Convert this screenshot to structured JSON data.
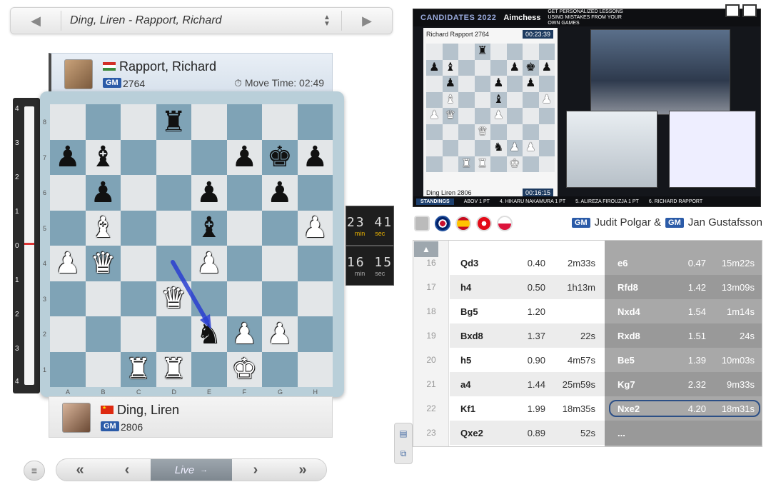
{
  "game_selector": {
    "title": "Ding, Liren - Rapport, Richard"
  },
  "top_player": {
    "name": "Rapport, Richard",
    "title": "GM",
    "rating": "2764",
    "move_time": "Move Time: 02:49"
  },
  "bottom_player": {
    "name": "Ding, Liren",
    "title": "GM",
    "rating": "2806"
  },
  "eval_bar": {
    "labels_top": [
      "4",
      "3",
      "2",
      "1",
      "0"
    ],
    "labels_bottom": [
      "1",
      "2",
      "3",
      "4"
    ],
    "evaluation": 0.0
  },
  "board": {
    "files": [
      "A",
      "B",
      "C",
      "D",
      "E",
      "F",
      "G",
      "H"
    ],
    "ranks": [
      "8",
      "7",
      "6",
      "5",
      "4",
      "3",
      "2",
      "1"
    ],
    "position": [
      [
        "",
        "",
        "",
        "r",
        "",
        "",
        "",
        ""
      ],
      [
        "p",
        "b",
        "",
        "",
        "",
        "p",
        "k",
        "p"
      ],
      [
        "",
        "p",
        "",
        "",
        "p",
        "",
        "p",
        ""
      ],
      [
        "",
        "B",
        "",
        "",
        "b",
        "",
        "",
        "P"
      ],
      [
        "P",
        "Q",
        "",
        "",
        "P",
        "",
        "",
        ""
      ],
      [
        "",
        "",
        "",
        "Q",
        "",
        "",
        "",
        ""
      ],
      [
        "",
        "",
        "",
        "",
        "n",
        "P",
        "P",
        ""
      ],
      [
        "",
        "",
        "R",
        "R",
        "",
        "K",
        "",
        ""
      ]
    ],
    "last_move_arrow": {
      "from": "d4",
      "to": "e2"
    }
  },
  "clocks": {
    "top": {
      "value": "23 41",
      "min_label": "min",
      "sec_label": "sec"
    },
    "bottom": {
      "value": "16 15",
      "min_label": "min",
      "sec_label": "sec"
    }
  },
  "nav": {
    "first": "«",
    "prev": "‹",
    "live": "Live",
    "next": "›",
    "last": "»",
    "menu": "≡"
  },
  "video": {
    "event": "CANDIDATES",
    "year": "2022",
    "sponsor": "Aimchess",
    "promo": "GET PERSONALIZED LESSONS USING MISTAKES FROM YOUR OWN GAMES",
    "board_top_player": "Richard Rapport 2764",
    "board_top_clock": "00:23:39",
    "board_bottom_player": "Ding Liren 2806",
    "board_bottom_clock": "00:16:15",
    "ticker": [
      "STANDINGS",
      "ABOV  1 PT",
      "4. HIKARU NAKAMURA  1 PT",
      "5. ALIREZA FIROUZJA  1 PT",
      "6. RICHARD RAPPORT"
    ]
  },
  "commentary": {
    "commentator_1_title": "GM",
    "commentator_1": "Judit Polgar &",
    "commentator_2_title": "GM",
    "commentator_2": "Jan Gustafsson",
    "language_flags": [
      "uk",
      "es",
      "tr",
      "pl"
    ]
  },
  "moves": [
    {
      "num": "16",
      "w": "Qd3",
      "weval": "0.40",
      "wtime": "2m33s",
      "b": "e6",
      "beval": "0.47",
      "btime": "15m22s"
    },
    {
      "num": "17",
      "w": "h4",
      "weval": "0.50",
      "wtime": "1h13m",
      "b": "Rfd8",
      "beval": "1.42",
      "btime": "13m09s"
    },
    {
      "num": "18",
      "w": "Bg5",
      "weval": "1.20",
      "wtime": "",
      "b": "Nxd4",
      "beval": "1.54",
      "btime": "1m14s"
    },
    {
      "num": "19",
      "w": "Bxd8",
      "weval": "1.37",
      "wtime": "22s",
      "b": "Rxd8",
      "beval": "1.51",
      "btime": "24s"
    },
    {
      "num": "20",
      "w": "h5",
      "weval": "0.90",
      "wtime": "4m57s",
      "b": "Be5",
      "beval": "1.39",
      "btime": "10m03s"
    },
    {
      "num": "21",
      "w": "a4",
      "weval": "1.44",
      "wtime": "25m59s",
      "b": "Kg7",
      "beval": "2.32",
      "btime": "9m33s"
    },
    {
      "num": "22",
      "w": "Kf1",
      "weval": "1.99",
      "wtime": "18m35s",
      "b": "Nxe2",
      "beval": "4.20",
      "btime": "18m31s"
    },
    {
      "num": "23",
      "w": "Qxe2",
      "weval": "0.89",
      "wtime": "52s",
      "b": "...",
      "beval": "",
      "btime": ""
    }
  ],
  "colors": {
    "board_light": "#e3e6e8",
    "board_dark": "#7fa3b6",
    "accent_blue": "#2b5ba8",
    "arrow": "#2a3fd1"
  }
}
